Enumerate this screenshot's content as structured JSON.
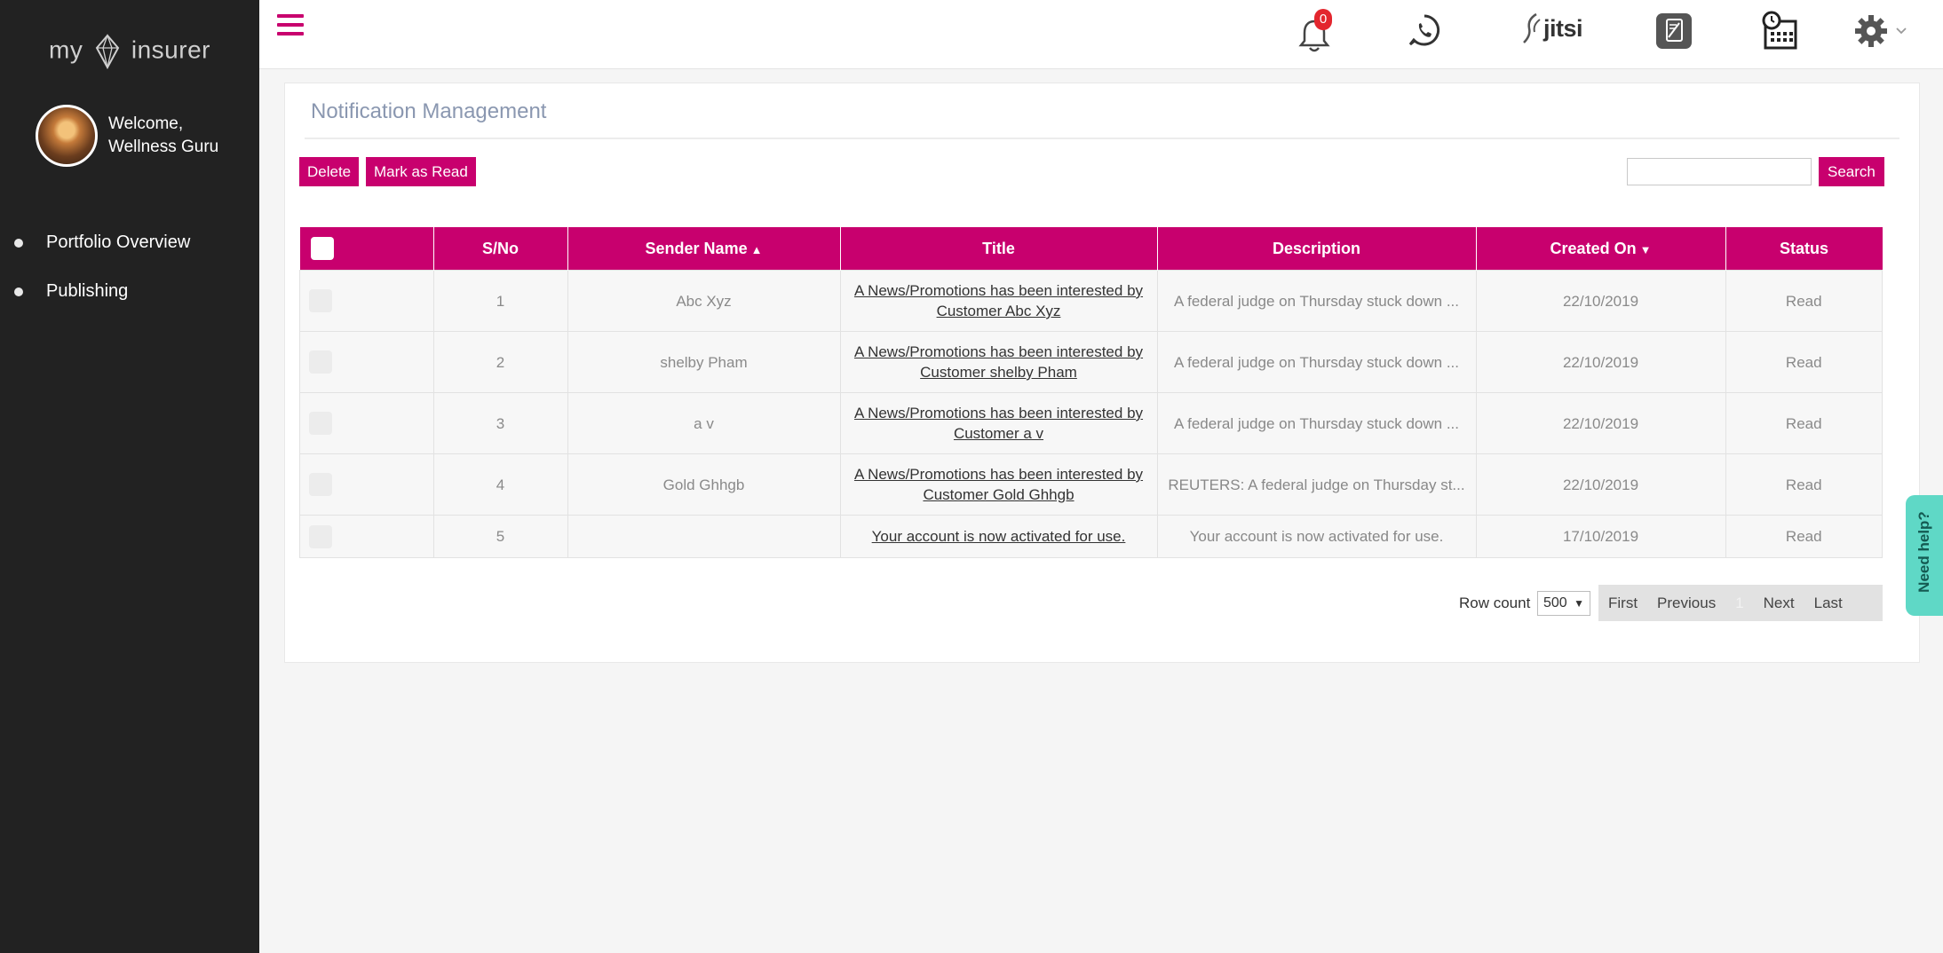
{
  "app": {
    "logo_left": "my",
    "logo_right": "insurer"
  },
  "user": {
    "welcome_line1": "Welcome,",
    "welcome_line2": "Wellness Guru"
  },
  "sidebar": {
    "items": [
      {
        "label": "Portfolio Overview"
      },
      {
        "label": "Publishing"
      }
    ]
  },
  "topbar": {
    "notification_count": "0",
    "jitsi_label": "jitsi",
    "icons": [
      "hamburger-menu-icon",
      "bell-icon",
      "whatsapp-icon",
      "jitsi-icon",
      "notes-icon",
      "calendar-clock-icon",
      "gear-icon"
    ]
  },
  "page": {
    "title": "Notification Management",
    "delete_label": "Delete",
    "mark_read_label": "Mark as Read",
    "search_label": "Search",
    "search_value": ""
  },
  "table": {
    "columns": {
      "sno": "S/No",
      "sender": "Sender Name",
      "title": "Title",
      "description": "Description",
      "created": "Created On",
      "status": "Status"
    },
    "rows": [
      {
        "sno": "1",
        "sender": "Abc Xyz",
        "title": "A News/Promotions has been interested by Customer Abc Xyz",
        "description": "A federal judge on Thursday stuck down ...",
        "created": "22/10/2019",
        "status": "Read"
      },
      {
        "sno": "2",
        "sender": "shelby Pham",
        "title": "A News/Promotions has been interested by Customer shelby Pham",
        "description": "A federal judge on Thursday stuck down ...",
        "created": "22/10/2019",
        "status": "Read"
      },
      {
        "sno": "3",
        "sender": "a v",
        "title": "A News/Promotions has been interested by Customer a v",
        "description": "A federal judge on Thursday stuck down ...",
        "created": "22/10/2019",
        "status": "Read"
      },
      {
        "sno": "4",
        "sender": "Gold Ghhgb",
        "title": "A News/Promotions has been interested by Customer Gold Ghhgb",
        "description": "REUTERS: A federal judge on Thursday st...",
        "created": "22/10/2019",
        "status": "Read"
      },
      {
        "sno": "5",
        "sender": "",
        "title": "Your account is now activated for use.",
        "description": "Your account is now activated for use.",
        "created": "17/10/2019",
        "status": "Read"
      }
    ]
  },
  "pager": {
    "row_count_label": "Row count",
    "row_count_value": "500",
    "first": "First",
    "previous": "Previous",
    "current": "1",
    "next": "Next",
    "last": "Last"
  },
  "help": {
    "label": "Need help?"
  },
  "colors": {
    "accent": "#c8006e",
    "sidebar": "#222222",
    "help": "#5fd8c6"
  }
}
